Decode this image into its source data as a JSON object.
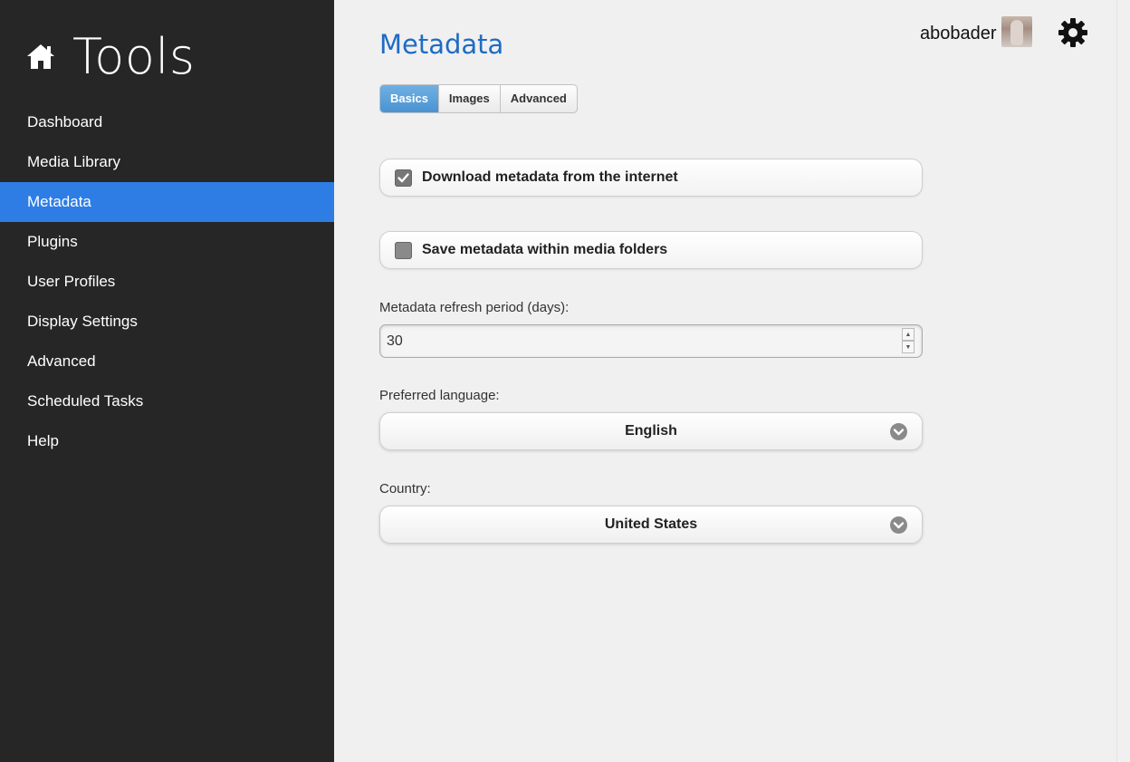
{
  "sidebar": {
    "brand_title": "Tools",
    "items": [
      {
        "label": "Dashboard"
      },
      {
        "label": "Media Library"
      },
      {
        "label": "Metadata"
      },
      {
        "label": "Plugins"
      },
      {
        "label": "User Profiles"
      },
      {
        "label": "Display Settings"
      },
      {
        "label": "Advanced"
      },
      {
        "label": "Scheduled Tasks"
      },
      {
        "label": "Help"
      }
    ],
    "active_index": 2
  },
  "header": {
    "username": "abobader",
    "settings_icon": "gear-icon"
  },
  "main": {
    "title": "Metadata",
    "tabs": [
      {
        "label": "Basics",
        "active": true
      },
      {
        "label": "Images",
        "active": false
      },
      {
        "label": "Advanced",
        "active": false
      }
    ],
    "download_metadata": {
      "label": "Download metadata from the internet",
      "checked": true
    },
    "save_metadata": {
      "label": "Save metadata within media folders",
      "checked": false
    },
    "refresh_period": {
      "label": "Metadata refresh period (days):",
      "value": "30"
    },
    "language": {
      "label": "Preferred language:",
      "value": "English"
    },
    "country": {
      "label": "Country:",
      "value": "United States"
    }
  },
  "colors": {
    "sidebar_bg": "#262626",
    "active_nav": "#2d7de5",
    "title": "#1f6bc4",
    "active_tab": "#4a93d1"
  }
}
